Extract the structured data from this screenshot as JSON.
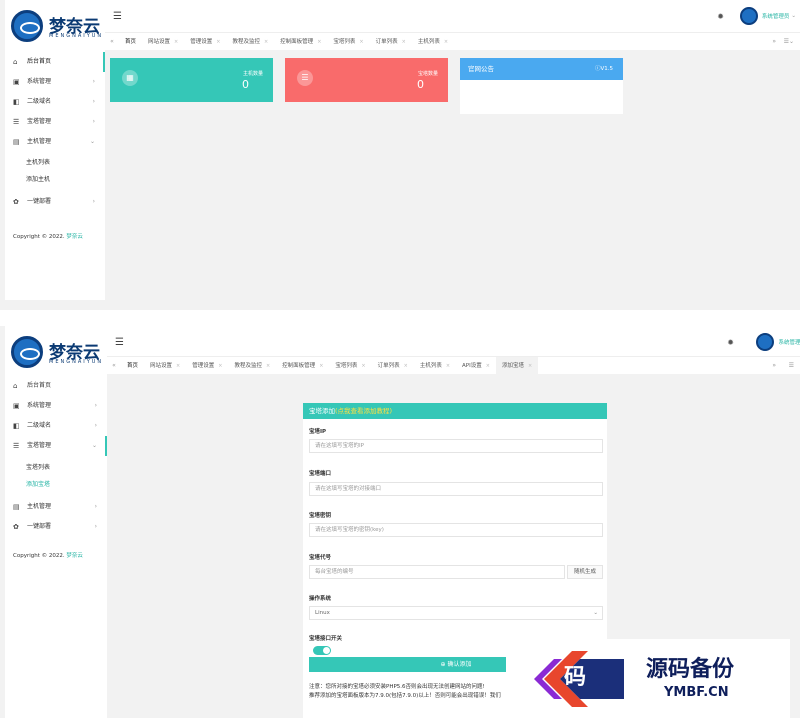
{
  "brand": {
    "name": "梦奈云",
    "sub": "MENGNAIYUN"
  },
  "user": {
    "name": "系统管理员"
  },
  "sidebar1": {
    "items": [
      {
        "icon": "⌂",
        "label": "后台首页"
      },
      {
        "icon": "▣",
        "label": "系统管理"
      },
      {
        "icon": "◧",
        "label": "二级域名"
      },
      {
        "icon": "☰",
        "label": "宝塔管理"
      },
      {
        "icon": "▤",
        "label": "主机管理"
      }
    ],
    "sub": [
      "主机列表",
      "添加主机"
    ],
    "last": {
      "icon": "✿",
      "label": "一键部署"
    }
  },
  "sidebar2": {
    "items": [
      {
        "icon": "⌂",
        "label": "后台首页"
      },
      {
        "icon": "▣",
        "label": "系统管理"
      },
      {
        "icon": "◧",
        "label": "二级域名"
      },
      {
        "icon": "☰",
        "label": "宝塔管理"
      }
    ],
    "sub": [
      "宝塔列表",
      "添加宝塔"
    ],
    "after": [
      {
        "icon": "▤",
        "label": "主机管理"
      },
      {
        "icon": "✿",
        "label": "一键部署"
      }
    ]
  },
  "copyright": {
    "text": "Copyright © 2022.",
    "link": "梦奈云"
  },
  "tabs1": [
    "首页",
    "网站设置",
    "管理设置",
    "教程及监控",
    "控制面板管理",
    "宝塔列表",
    "订单列表",
    "主机列表"
  ],
  "tabs2": [
    "首页",
    "网站设置",
    "管理设置",
    "教程及监控",
    "控制面板管理",
    "宝塔列表",
    "订单列表",
    "主机列表",
    "API设置",
    "添加宝塔"
  ],
  "cards": [
    {
      "icon": "▦",
      "label": "主机数量",
      "value": "0",
      "color": "#35c7b7"
    },
    {
      "icon": "☰",
      "label": "宝塔数量",
      "value": "0",
      "color": "#f96b6b"
    }
  ],
  "notice": {
    "title": "官网公告",
    "version": "V1.5"
  },
  "form": {
    "title": "宝塔添加",
    "link": "(点我查看添加教程)",
    "fields": [
      {
        "label": "宝塔IP",
        "placeholder": "请在这填写宝塔的IP"
      },
      {
        "label": "宝塔端口",
        "placeholder": "请在这填写宝塔的对接端口"
      },
      {
        "label": "宝塔密钥",
        "placeholder": "请在这填写宝塔的密钥(key)"
      },
      {
        "label": "宝塔代号",
        "placeholder": "每台宝塔的编号"
      }
    ],
    "random_label": "随机生成",
    "os_label": "操作系统",
    "os_value": "Linux",
    "switch_label": "宝塔接口开关",
    "submit": "确认添加",
    "note1": "注意：您所对接的宝塔必须安装PHP5.6否则会出现无法创建网站的问题!",
    "note2": "推荐添加的宝塔面板版本为7.9.0(包括7.9.0)以上！否则可能会出现错误！我们"
  },
  "watermark": {
    "glyph": "码",
    "big": "源码备份",
    "small": "YMBF.CN"
  }
}
